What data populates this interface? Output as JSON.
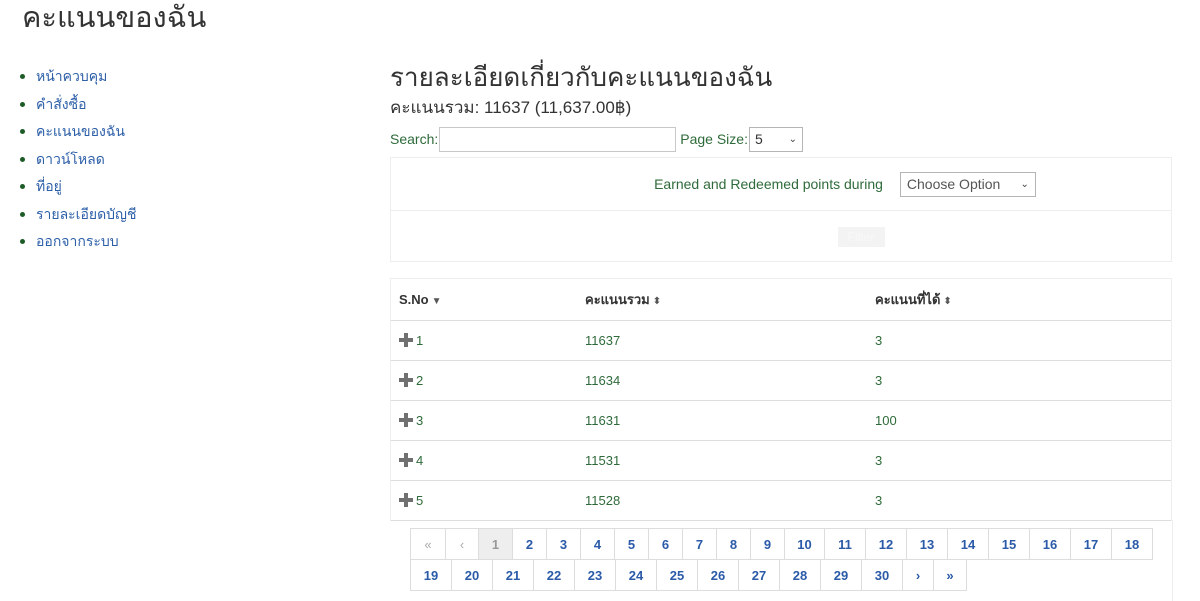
{
  "page": {
    "title": "คะแนนของฉัน"
  },
  "sidebar": {
    "items": [
      {
        "label": "หน้าควบคุม"
      },
      {
        "label": "คำสั่งซื้อ"
      },
      {
        "label": "คะแนนของฉัน"
      },
      {
        "label": "ดาวน์โหลด"
      },
      {
        "label": "ที่อยู่"
      },
      {
        "label": "รายละเอียดบัญชี"
      },
      {
        "label": "ออกจากระบบ"
      }
    ]
  },
  "main": {
    "title": "รายละเอียดเกี่ยวกับคะแนนของฉัน",
    "total_points": "คะแนนรวม: 11637 (11,637.00฿)",
    "search_label": "Search:",
    "search_value": "",
    "page_size_label": "Page Size:",
    "page_size_value": "5"
  },
  "filter": {
    "label": "Earned and Redeemed points during",
    "select_value": "Choose Option",
    "button_label": "Filter"
  },
  "table": {
    "columns": [
      {
        "label": "S.No",
        "sort_icon": "▼"
      },
      {
        "label": "คะแนนรวม",
        "sort_icon": "⬍"
      },
      {
        "label": "คะแนนที่ได้",
        "sort_icon": "⬍"
      }
    ],
    "rows": [
      {
        "sno": "1",
        "total": "11637",
        "earned": "3"
      },
      {
        "sno": "2",
        "total": "11634",
        "earned": "3"
      },
      {
        "sno": "3",
        "total": "11631",
        "earned": "100"
      },
      {
        "sno": "4",
        "total": "11531",
        "earned": "3"
      },
      {
        "sno": "5",
        "total": "11528",
        "earned": "3"
      }
    ]
  },
  "pagination": {
    "first": "«",
    "prev": "‹",
    "next": "›",
    "last": "»",
    "current_page": "1",
    "pages": [
      "1",
      "2",
      "3",
      "4",
      "5",
      "6",
      "7",
      "8",
      "9",
      "10",
      "11",
      "12",
      "13",
      "14",
      "15",
      "16",
      "17",
      "18",
      "19",
      "20",
      "21",
      "22",
      "23",
      "24",
      "25",
      "26",
      "27",
      "28",
      "29",
      "30"
    ]
  }
}
